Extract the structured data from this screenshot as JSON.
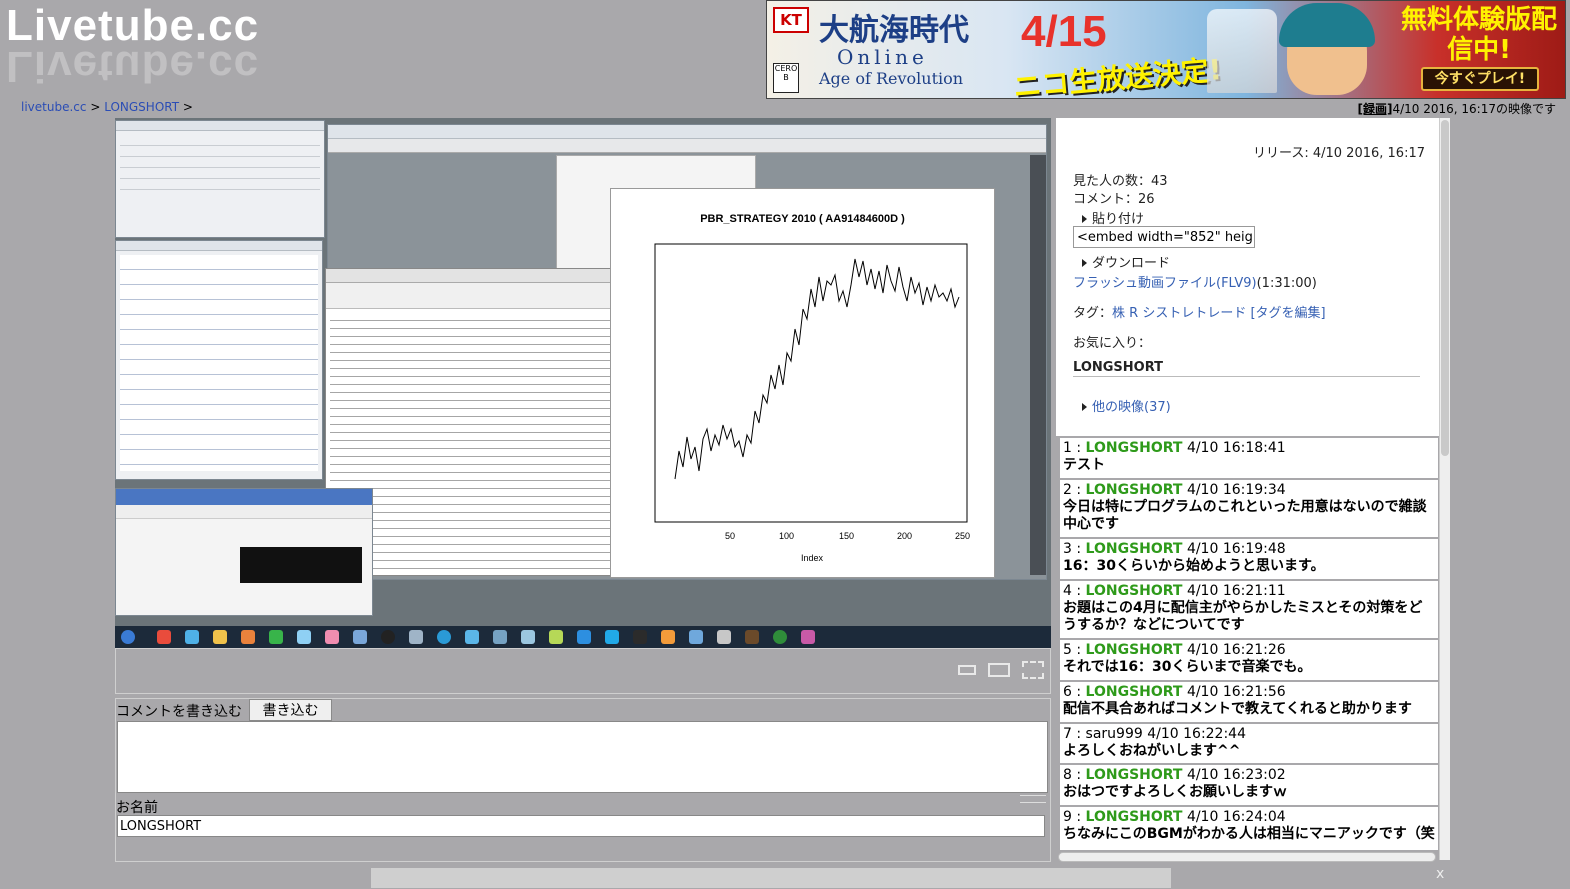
{
  "site": {
    "logo_text": "Livetube.cc"
  },
  "banner": {
    "kt_logo": "KT",
    "cero": "CERO B",
    "game_title_jp": "大航海時代",
    "game_title_online": "Online",
    "game_subtitle": "Age of Revolution",
    "date": "4/15",
    "headline": "ニコ生放送決定!",
    "cta_text": "無料体験版配信中!",
    "cta_button": "今すぐプレイ!"
  },
  "breadcrumb": {
    "home": "livetube.cc",
    "separator": ">",
    "channel": "LONGSHORT"
  },
  "recording": {
    "tag": "[録画]",
    "text": "4/10 2016, 16:17の映像です"
  },
  "player_chart": {
    "title": "PBR_STRATEGY 2010 ( AA91484600D )",
    "xlabel": "Index",
    "ticks": [
      "50",
      "100",
      "150",
      "200",
      "250"
    ]
  },
  "comment_form": {
    "label": "コメントを書き込む",
    "button": "書き込む",
    "name_label": "お名前",
    "name_value": "LONGSHORT"
  },
  "info": {
    "release": "リリース: 4/10 2016, 16:17",
    "viewers": "見た人の数：43",
    "comments": "コメント：26",
    "paste_label": "貼り付け",
    "embed_code": "<embed width=\"852\" heig",
    "download_label": "ダウンロード",
    "flv_link": "フラッシュ動画ファイル(FLV9)",
    "flv_duration": "(1:31:00)",
    "tags_label": "タグ：",
    "tags": "株 R シストレトレード",
    "tag_edit": "[タグを編集]",
    "favorites_label": "お気に入り：",
    "channel_name": "LONGSHORT",
    "other_videos": "他の映像(37)"
  },
  "comments": [
    {
      "num": "1",
      "user": "LONGSHORT",
      "time": "4/10 16:18:41",
      "text": "テスト"
    },
    {
      "num": "2",
      "user": "LONGSHORT",
      "time": "4/10 16:19:34",
      "text": "今日は特にプログラムのこれといった用意はないので雑談中心です"
    },
    {
      "num": "3",
      "user": "LONGSHORT",
      "time": "4/10 16:19:48",
      "text": "16：30くらいから始めようと思います。"
    },
    {
      "num": "4",
      "user": "LONGSHORT",
      "time": "4/10 16:21:11",
      "text": "お題はこの4月に配信主がやらかしたミスとその対策をどうするか？などについてです"
    },
    {
      "num": "5",
      "user": "LONGSHORT",
      "time": "4/10 16:21:26",
      "text": "それでは16：30くらいまで音楽でも。"
    },
    {
      "num": "6",
      "user": "LONGSHORT",
      "time": "4/10 16:21:56",
      "text": "配信不具合あればコメントで教えてくれると助かります"
    },
    {
      "num": "7",
      "user": "saru999",
      "time": "4/10 16:22:44",
      "text": "よろしくおねがいします^^"
    },
    {
      "num": "8",
      "user": "LONGSHORT",
      "time": "4/10 16:23:02",
      "text": "おはつですよろしくお願いしますｗ"
    },
    {
      "num": "9",
      "user": "LONGSHORT",
      "time": "4/10 16:24:04",
      "text": "ちなみにこのBGMがわかる人は相当にマニアックです（笑"
    }
  ],
  "close": "x"
}
